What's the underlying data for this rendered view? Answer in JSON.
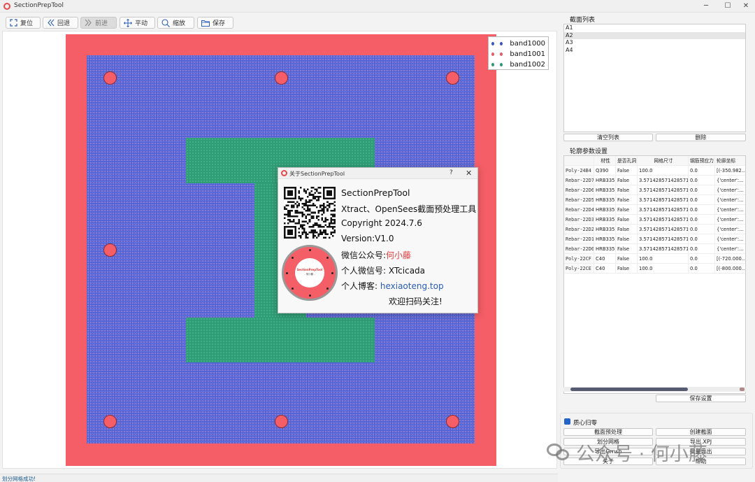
{
  "window": {
    "title": "SectionPrepTool",
    "min": "─",
    "max": "☐",
    "close": "✕"
  },
  "toolbar": {
    "reset": "复位",
    "back": "回退",
    "forward": "前进",
    "pan": "平动",
    "zoom": "缩放",
    "save": "保存"
  },
  "legend": [
    {
      "label": "band1000",
      "color": "#3a56c8"
    },
    {
      "label": "band1001",
      "color": "#e85a64"
    },
    {
      "label": "band1002",
      "color": "#2b9a74"
    }
  ],
  "dialog": {
    "title": "关于SectionPrepTool",
    "help": "?",
    "close": "✕",
    "app_name": "SectionPrepTool",
    "description": "Xtract、OpenSees截面预处理工具",
    "copyright": "Copyright 2024.7.6",
    "version": "Version:V1.0",
    "wechat_label": "微信公众号:",
    "wechat_value": "何小藤",
    "personal_label": "个人微信号: ",
    "personal_value": "XTcicada",
    "blog_label": "个人博客: ",
    "blog_value": "hexiaoteng.top",
    "footer": "欢迎扫码关注!",
    "seal_text": "SectionPrepTool",
    "seal_sub": "- 何小藤 -"
  },
  "sections": {
    "label": "截面列表",
    "items": [
      "A1",
      "A2",
      "A3",
      "A4"
    ],
    "selected_index": 1,
    "clear": "清空列表",
    "delete": "删除"
  },
  "profile": {
    "label": "轮廓参数设置",
    "headers": [
      "材性",
      "是否孔洞",
      "网格尺寸",
      "钢筋预应力",
      "轮廓坐标"
    ],
    "rows": [
      {
        "name": "Poly-24B4",
        "mat": "Q390",
        "hole": "False",
        "mesh": "100.0",
        "pre": "0.0",
        "coord": "[(-350.982..."
      },
      {
        "name": "Rebar-22D7",
        "mat": "HRB335",
        "hole": "False",
        "mesh": "3.5714285714285716",
        "pre": "0.0",
        "coord": "{'center':..."
      },
      {
        "name": "Rebar-22D6",
        "mat": "HRB335",
        "hole": "False",
        "mesh": "3.5714285714285716",
        "pre": "0.0",
        "coord": "{'center':..."
      },
      {
        "name": "Rebar-22D5",
        "mat": "HRB335",
        "hole": "False",
        "mesh": "3.5714285714285716",
        "pre": "0.0",
        "coord": "{'center':..."
      },
      {
        "name": "Rebar-22D4",
        "mat": "HRB335",
        "hole": "False",
        "mesh": "3.5714285714285716",
        "pre": "0.0",
        "coord": "{'center':..."
      },
      {
        "name": "Rebar-22D3",
        "mat": "HRB335",
        "hole": "False",
        "mesh": "3.5714285714285716",
        "pre": "0.0",
        "coord": "{'center':..."
      },
      {
        "name": "Rebar-22D2",
        "mat": "HRB335",
        "hole": "False",
        "mesh": "3.5714285714285716",
        "pre": "0.0",
        "coord": "{'center':..."
      },
      {
        "name": "Rebar-22D1",
        "mat": "HRB335",
        "hole": "False",
        "mesh": "3.5714285714285716",
        "pre": "0.0",
        "coord": "{'center':..."
      },
      {
        "name": "Rebar-22D0",
        "mat": "HRB335",
        "hole": "False",
        "mesh": "3.5714285714285716",
        "pre": "0.0",
        "coord": "{'center':..."
      },
      {
        "name": "Poly-22CF",
        "mat": "C40",
        "hole": "False",
        "mesh": "100.0",
        "pre": "0.0",
        "coord": "[(-720.000..."
      },
      {
        "name": "Poly-22CE",
        "mat": "C40",
        "hole": "False",
        "mesh": "100.0",
        "pre": "0.0",
        "coord": "[(-800.000..."
      }
    ],
    "save": "保存设置"
  },
  "bottom": {
    "centroid": "质心归零",
    "preprocess": "截面预处理",
    "create": "创建截面",
    "mesh": "划分网格",
    "export_xpj": "导出.XPJ",
    "export_gmsh": "导出Gmsh",
    "batch_export": "批量导出",
    "about": "关于",
    "help": "帮助"
  },
  "status": "划分网格成功!",
  "watermark": "公众号 · 何小藤"
}
